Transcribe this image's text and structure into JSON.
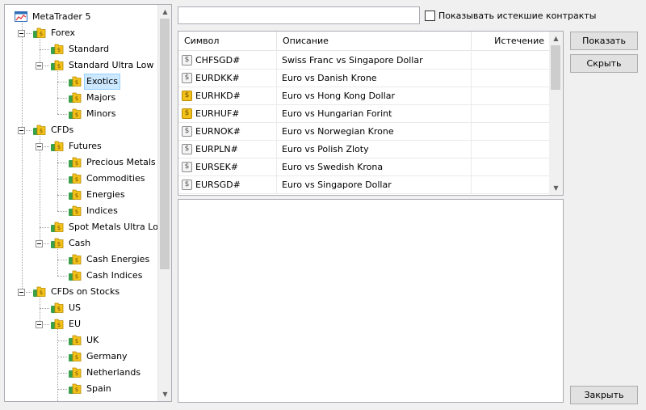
{
  "tree": {
    "nodes": [
      {
        "label": "MetaTrader 5",
        "level": 0,
        "expander": false,
        "icon": "metatrader-icon"
      },
      {
        "label": "Forex",
        "level": 1,
        "expander": true,
        "icon": "folder-icon"
      },
      {
        "label": "Standard",
        "level": 2,
        "expander": false,
        "icon": "folder-icon"
      },
      {
        "label": "Standard Ultra Low",
        "level": 2,
        "expander": true,
        "icon": "folder-icon"
      },
      {
        "label": "Exotics",
        "level": 3,
        "expander": false,
        "icon": "folder-icon",
        "selected": true
      },
      {
        "label": "Majors",
        "level": 3,
        "expander": false,
        "icon": "folder-icon"
      },
      {
        "label": "Minors",
        "level": 3,
        "expander": false,
        "icon": "folder-icon"
      },
      {
        "label": "CFDs",
        "level": 1,
        "expander": true,
        "icon": "folder-icon"
      },
      {
        "label": "Futures",
        "level": 2,
        "expander": true,
        "icon": "folder-icon"
      },
      {
        "label": "Precious Metals",
        "level": 3,
        "expander": false,
        "icon": "folder-icon"
      },
      {
        "label": "Commodities",
        "level": 3,
        "expander": false,
        "icon": "folder-icon"
      },
      {
        "label": "Energies",
        "level": 3,
        "expander": false,
        "icon": "folder-icon"
      },
      {
        "label": "Indices",
        "level": 3,
        "expander": false,
        "icon": "folder-icon"
      },
      {
        "label": "Spot Metals Ultra Low",
        "level": 2,
        "expander": false,
        "icon": "folder-icon"
      },
      {
        "label": "Cash",
        "level": 2,
        "expander": true,
        "icon": "folder-icon"
      },
      {
        "label": "Cash Energies",
        "level": 3,
        "expander": false,
        "icon": "folder-icon"
      },
      {
        "label": "Cash Indices",
        "level": 3,
        "expander": false,
        "icon": "folder-icon"
      },
      {
        "label": "CFDs on Stocks",
        "level": 1,
        "expander": true,
        "icon": "folder-icon"
      },
      {
        "label": "US",
        "level": 2,
        "expander": false,
        "icon": "folder-icon"
      },
      {
        "label": "EU",
        "level": 2,
        "expander": true,
        "icon": "folder-icon"
      },
      {
        "label": "UK",
        "level": 3,
        "expander": false,
        "icon": "folder-icon"
      },
      {
        "label": "Germany",
        "level": 3,
        "expander": false,
        "icon": "folder-icon"
      },
      {
        "label": "Netherlands",
        "level": 3,
        "expander": false,
        "icon": "folder-icon"
      },
      {
        "label": "Spain",
        "level": 3,
        "expander": false,
        "icon": "folder-icon"
      }
    ]
  },
  "search": {
    "value": "",
    "placeholder": ""
  },
  "expired_checkbox": {
    "label": "Показывать истекшие контракты",
    "checked": false
  },
  "table": {
    "columns": [
      "Символ",
      "Описание",
      "Истечение"
    ],
    "rows": [
      {
        "symbol": "CHFSGD#",
        "description": "Swiss Franc vs Singapore Dollar",
        "expiration": "",
        "icon": "symbol-gray-icon"
      },
      {
        "symbol": "EURDKK#",
        "description": "Euro vs Danish Krone",
        "expiration": "",
        "icon": "symbol-gray-icon"
      },
      {
        "symbol": "EURHKD#",
        "description": "Euro vs Hong Kong Dollar",
        "expiration": "",
        "icon": "symbol-gold-icon"
      },
      {
        "symbol": "EURHUF#",
        "description": "Euro vs Hungarian Forint",
        "expiration": "",
        "icon": "symbol-gold-icon"
      },
      {
        "symbol": "EURNOK#",
        "description": "Euro vs Norwegian Krone",
        "expiration": "",
        "icon": "symbol-gray-icon"
      },
      {
        "symbol": "EURPLN#",
        "description": "Euro vs Polish Zloty",
        "expiration": "",
        "icon": "symbol-gray-icon"
      },
      {
        "symbol": "EURSEK#",
        "description": "Euro vs Swedish Krona",
        "expiration": "",
        "icon": "symbol-gray-icon"
      },
      {
        "symbol": "EURSGD#",
        "description": "Euro vs Singapore Dollar",
        "expiration": "",
        "icon": "symbol-gray-icon"
      }
    ]
  },
  "buttons": {
    "show": "Показать",
    "hide": "Скрыть",
    "close": "Закрыть"
  },
  "colors": {
    "selection": "#cce8ff",
    "folder_gold": "#e8b51c",
    "folder_green": "#3aa04a",
    "border": "#abadb3"
  }
}
